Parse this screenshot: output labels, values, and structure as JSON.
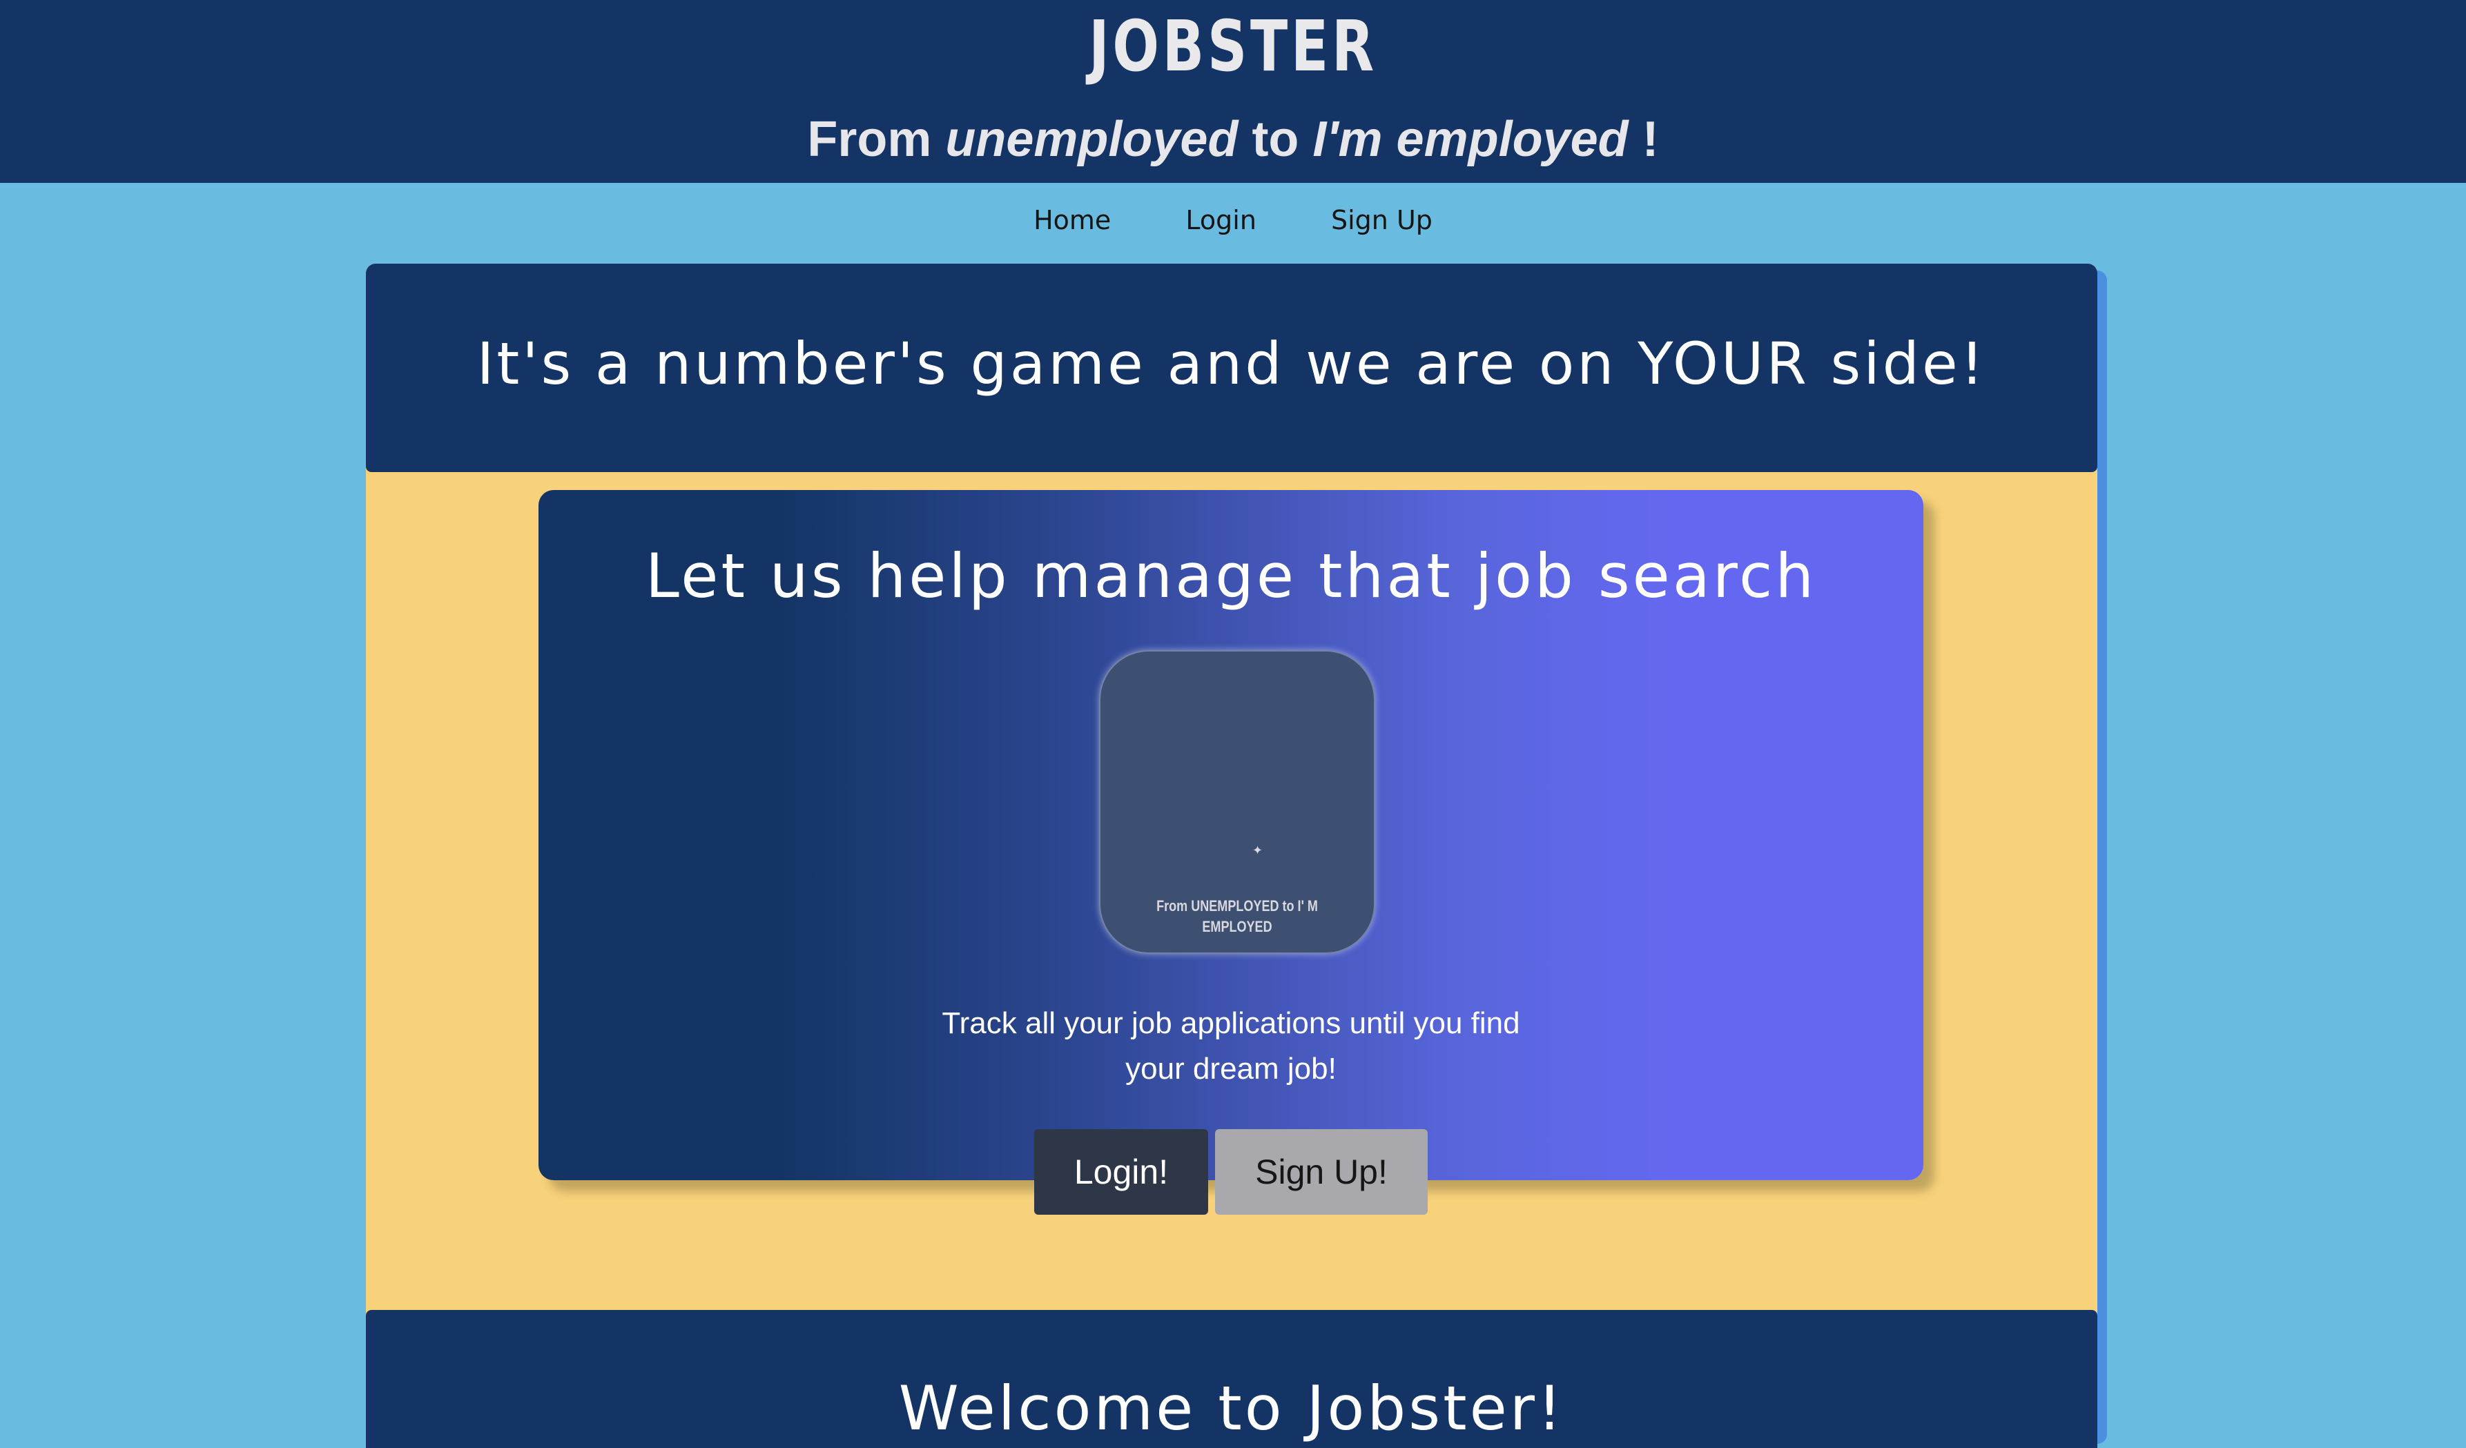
{
  "header": {
    "logo": "JOBSTER",
    "tagline": {
      "part1": "From ",
      "part2": "unemployed",
      "part3": " to ",
      "part4": "I'm employed",
      "part5": " !"
    }
  },
  "nav": {
    "items": [
      {
        "label": "Home"
      },
      {
        "label": "Login"
      },
      {
        "label": "Sign Up"
      }
    ]
  },
  "banner": {
    "title": "It's a number's game and we are on YOUR side!"
  },
  "hero": {
    "title": "Let us help manage that job search",
    "preview": {
      "caption": "From UNEMPLOYED to I' M EMPLOYED"
    },
    "description_line1": "Track all your job applications until you find",
    "description_line2": "your dream job!",
    "login_button": "Login!",
    "signup_button": "Sign Up!"
  },
  "bottom": {
    "title": "Welcome to Jobster!"
  },
  "colors": {
    "header_bg": "#133464",
    "page_bg": "#69bbe0",
    "card_bg": "#f7d27a",
    "gradient_start": "#133464",
    "gradient_end": "#6468f0",
    "login_button_bg": "#2d3748",
    "signup_button_bg": "#a9a9ad"
  }
}
